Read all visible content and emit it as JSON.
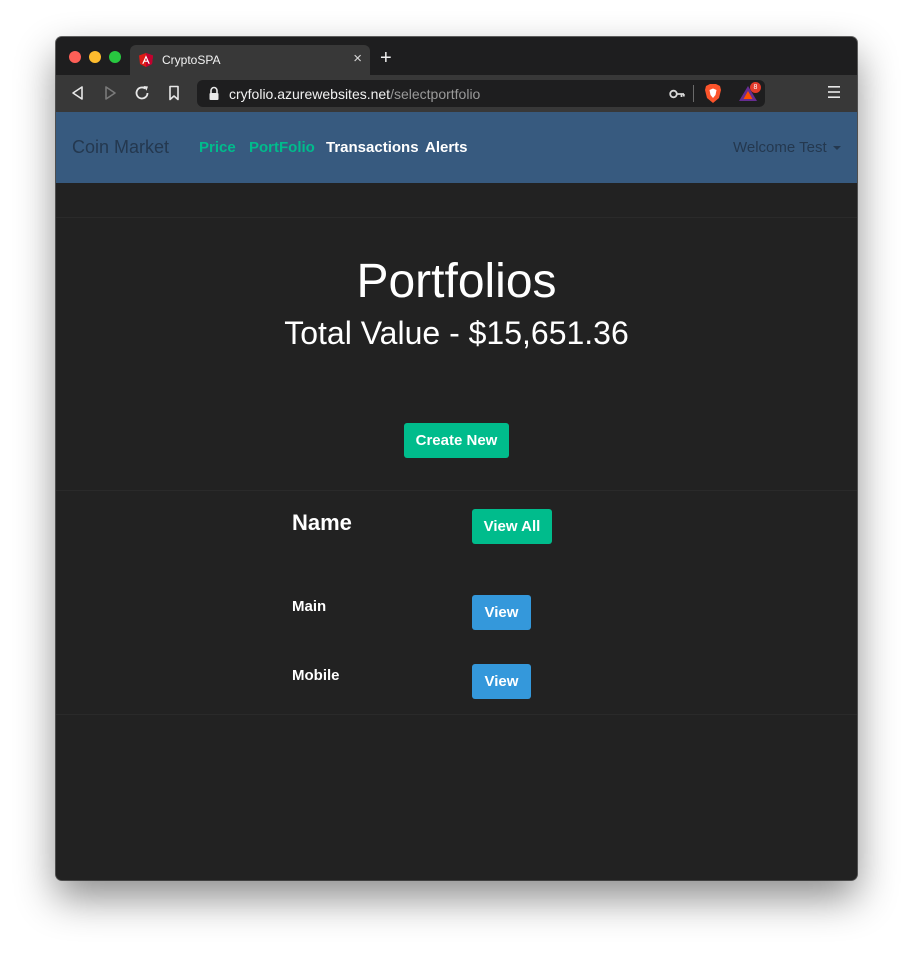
{
  "browser": {
    "tab_title": "CryptoSPA",
    "tab_close": "×",
    "new_tab": "+",
    "url_host": "cryfolio.azurewebsites.net",
    "url_path": "/selectportfolio",
    "rewards_badge": "8"
  },
  "navbar": {
    "brand": "Coin Market",
    "links": [
      {
        "label": "Price",
        "active": true
      },
      {
        "label": "PortFolio",
        "active": true
      },
      {
        "label": "Transactions",
        "active": false
      },
      {
        "label": "Alerts",
        "active": false
      }
    ],
    "user_menu": "Welcome Test"
  },
  "main": {
    "title": "Portfolios",
    "total_value": "Total Value - $15,651.36",
    "create_button": "Create New",
    "table": {
      "header_name": "Name",
      "view_all_button": "View All",
      "rows": [
        {
          "name": "Main",
          "action": "View"
        },
        {
          "name": "Mobile",
          "action": "View"
        }
      ]
    }
  },
  "colors": {
    "navbar_bg": "#375a7f",
    "success": "#00bc8c",
    "info": "#3498db",
    "page_bg": "#222222"
  }
}
